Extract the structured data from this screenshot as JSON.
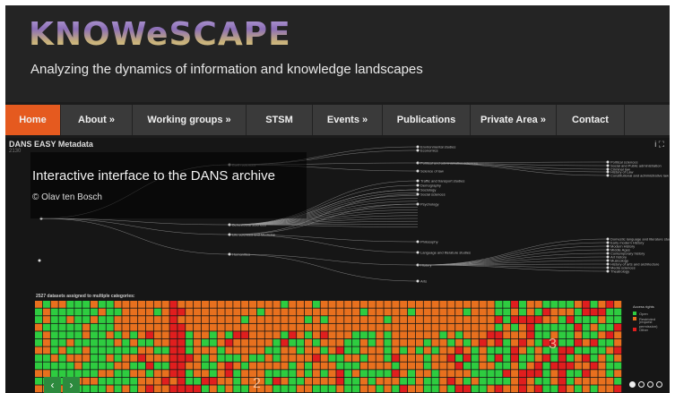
{
  "header": {
    "logo_text": "KNOWeSCAPE",
    "tagline": "Analyzing the dynamics of information and knowledge landscapes"
  },
  "nav": {
    "items": [
      {
        "label": "Home",
        "active": true
      },
      {
        "label": "About »",
        "active": false
      },
      {
        "label": "Working groups »",
        "active": false
      },
      {
        "label": "STSM",
        "active": false
      },
      {
        "label": "Events »",
        "active": false
      },
      {
        "label": "Publications",
        "active": false
      },
      {
        "label": "Private Area »",
        "active": false
      },
      {
        "label": "Contact",
        "active": false
      }
    ]
  },
  "slide": {
    "viz_title": "DANS EASY Metadata",
    "viz_subtitle": "2130",
    "tools": "i  ⛶",
    "caption_title": "Interactive interface to the DANS archive",
    "caption_author": "© Olav ten Bosch",
    "grid_label": "2527 datasets assigned to multiple categories:",
    "numbers": {
      "two": "2",
      "three": "3"
    },
    "legend": {
      "title": "Access rights",
      "items": [
        {
          "label": "Open",
          "color": "#2ecc40"
        },
        {
          "label": "Restricted",
          "color": "#e8701e"
        },
        {
          "label": "(request permission)",
          "color": ""
        },
        {
          "label": "Other",
          "color": "#e01e1e"
        }
      ]
    },
    "tree_labels": {
      "root": [
        "Earth sciences",
        "Behavioural sciences",
        "Life sciences and Medicine",
        "Humanities"
      ],
      "branch": [
        "Environmental studies",
        "Economics",
        "Political and administrative sciences",
        "Science of law",
        "Traffic and transport studies",
        "Demography",
        "Sociology",
        "Social sciences",
        "Psychology",
        "Philosophy",
        "Language and literature studies",
        "History",
        "Arts"
      ],
      "leaf": [
        "Political sciences",
        "Social and Public administration",
        "Criminal law",
        "History of Law",
        "Constitutional and administrative law",
        "Domestic language and literature studies",
        "Early modern History",
        "Modern History",
        "Middle Ages",
        "Contemporary history",
        "Art history",
        "Musicology",
        "History of arts and architecture",
        "Media sciences",
        "Theatrology"
      ]
    },
    "colors": {
      "open": "#2ecc40",
      "restricted": "#e8701e",
      "other": "#e01e1e"
    }
  },
  "controls": {
    "prev": "‹",
    "next": "›",
    "dots": [
      true,
      false,
      false,
      false
    ]
  }
}
